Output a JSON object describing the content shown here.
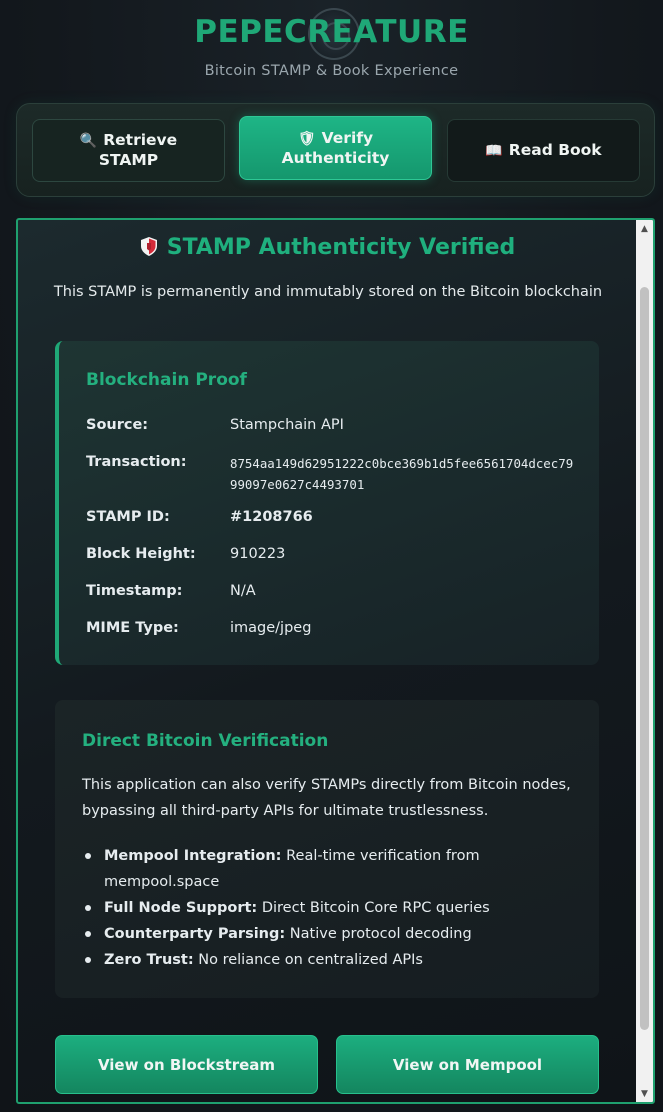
{
  "header": {
    "title": "PEPECREATURE",
    "subtitle": "Bitcoin STAMP & Book Experience"
  },
  "tabs": [
    {
      "icon": "🔍",
      "line1": "Retrieve",
      "line2": "STAMP",
      "active": false
    },
    {
      "icon": "🛡",
      "line1": "Verify",
      "line2": "Authenticity",
      "active": true
    },
    {
      "icon": "📖",
      "line1": "Read Book",
      "line2": "",
      "active": false
    }
  ],
  "verification": {
    "title": "STAMP Authenticity Verified",
    "description": "This STAMP is permanently and immutably stored on the Bitcoin blockchain"
  },
  "proof": {
    "title": "Blockchain Proof",
    "rows": [
      {
        "label": "Source:",
        "value": "Stampchain API"
      },
      {
        "label": "Transaction:",
        "value": "8754aa149d62951222c0bce369b1d5fee6561704dcec7999097e0627c4493701"
      },
      {
        "label": "STAMP ID:",
        "value": "#1208766"
      },
      {
        "label": "Block Height:",
        "value": "910223"
      },
      {
        "label": "Timestamp:",
        "value": "N/A"
      },
      {
        "label": "MIME Type:",
        "value": "image/jpeg"
      }
    ]
  },
  "direct": {
    "title": "Direct Bitcoin Verification",
    "description": "This application can also verify STAMPs directly from Bitcoin nodes, bypassing all third-party APIs for ultimate trustlessness.",
    "features": [
      {
        "bold": "Mempool Integration:",
        "text": " Real-time verification from mempool.space"
      },
      {
        "bold": "Full Node Support:",
        "text": " Direct Bitcoin Core RPC queries"
      },
      {
        "bold": "Counterparty Parsing:",
        "text": " Native protocol decoding"
      },
      {
        "bold": "Zero Trust:",
        "text": " No reliance on centralized APIs"
      }
    ]
  },
  "buttons": {
    "blockstream": "View on Blockstream",
    "mempool": "View on Mempool"
  },
  "colors": {
    "accent": "#1fa877",
    "active_tab": "#1eb586",
    "background": "#12171c"
  },
  "icons": {
    "retrieve": "magnifier-icon",
    "verify": "shield-icon",
    "read": "book-icon"
  }
}
